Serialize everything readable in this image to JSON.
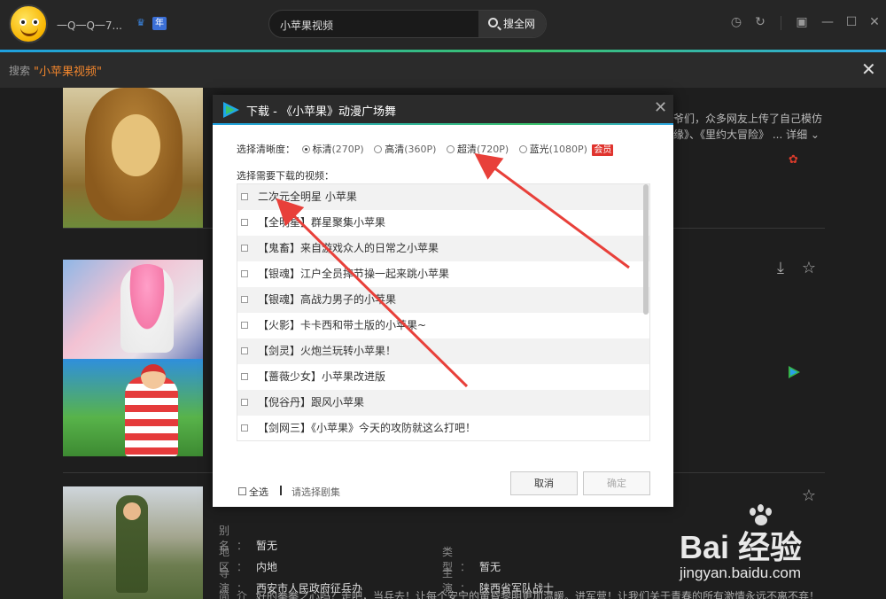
{
  "app": {
    "username": "一Q一Q一7...",
    "year_badge": "年"
  },
  "search": {
    "query": "小苹果视频",
    "button_label": "搜全网"
  },
  "search_strip": {
    "prefix": "搜索",
    "keyword": "\"小苹果视频\""
  },
  "background": {
    "desc_line1": "爷们，众多网友上传了自己模仿",
    "desc_line2": "缘》、《里约大冒险》 ... 详细",
    "info": {
      "alias_label": "别名：",
      "alias_value": "暂无",
      "region_label": "地区：",
      "region_value": "内地",
      "type_label": "类型：",
      "type_value": "暂无",
      "director_label": "导演：",
      "director_value": "西安市人民政府征兵办",
      "cast_label": "主演：",
      "cast_value": "陕西省军队战士",
      "intro_label": "简介：",
      "intro_value": "好的拳拳之心吗？走吧，当兵去！让每个安宁的黄昏黎明更加温暖。进军营！让我们关于青春的所有激情永远不离不弃！"
    }
  },
  "dialog": {
    "title": "下载 - 《小苹果》动漫广场舞",
    "quality_label": "选择清晰度：",
    "quality_options": [
      {
        "name": "标清",
        "note": "(270P)",
        "selected": true
      },
      {
        "name": "高清",
        "note": "(360P)",
        "selected": false
      },
      {
        "name": "超清",
        "note": "(720P)",
        "selected": false
      },
      {
        "name": "蓝光",
        "note": "(1080P)",
        "selected": false
      }
    ],
    "vip_tag": "会员",
    "select_label": "选择需要下载的视频：",
    "videos": [
      "二次元全明星 小苹果",
      "【全明星】群星聚集小苹果",
      "【鬼畜】来自游戏众人的日常之小苹果",
      "【银魂】江户全员摔节操一起来跳小苹果",
      "【银魂】高战力男子的小苹果",
      "【火影】卡卡西和带土版的小苹果~",
      "【剑灵】火炮兰玩转小苹果！",
      "【蔷薇少女】小苹果改进版",
      "【倪谷丹】跟风小苹果",
      "【剑网三】《小苹果》今天的攻防就这么打吧！"
    ],
    "select_all": "全选",
    "hint": "请选择剧集",
    "cancel_label": "取消",
    "ok_label": "确定"
  },
  "watermark": {
    "brand": "Bai  经验",
    "url": "jingyan.baidu.com"
  },
  "colors": {
    "accent_orange": "#f2862d",
    "vip_red": "#e0342e",
    "arrow_red": "#e8403a",
    "gradient_blue": "#1fa0e0",
    "gradient_green": "#3bc26b"
  },
  "icons": [
    "history-icon",
    "refresh-icon",
    "mini-mode-icon",
    "minimize-icon",
    "maximize-icon",
    "close-icon",
    "search-icon",
    "download-icon",
    "star-icon",
    "chevron-down-icon"
  ]
}
